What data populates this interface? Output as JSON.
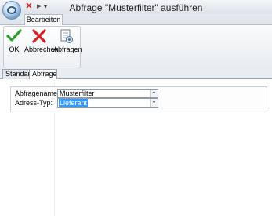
{
  "window": {
    "title": "Abfrage \"Musterfilter\" ausführen"
  },
  "quick_access": {
    "close_glyph": "✕",
    "arrow_glyph": "▶",
    "menu_glyph": "▾"
  },
  "window_controls": {
    "help_glyph": "1"
  },
  "ribbon": {
    "tabs": [
      {
        "label": "Bearbeiten"
      }
    ],
    "buttons": [
      {
        "label": "OK",
        "icon": "checkmark-icon"
      },
      {
        "label": "Abbrechen",
        "icon": "red-x-icon"
      },
      {
        "label": "Abfragen",
        "icon": "query-document-icon"
      }
    ]
  },
  "doc_tabs": [
    {
      "label": "Standard"
    },
    {
      "label": "Abfrage"
    }
  ],
  "form": {
    "fields": [
      {
        "label": "Abfragename:",
        "value": "Musterfilter"
      },
      {
        "label": "Adress-Typ:",
        "value": "Lieferant"
      }
    ],
    "dropdown_glyph": "▾"
  },
  "colors": {
    "accent": "#2a56a8",
    "selection": "#3399ff",
    "ok_green": "#2e9e2e",
    "cancel_red": "#d42020"
  }
}
